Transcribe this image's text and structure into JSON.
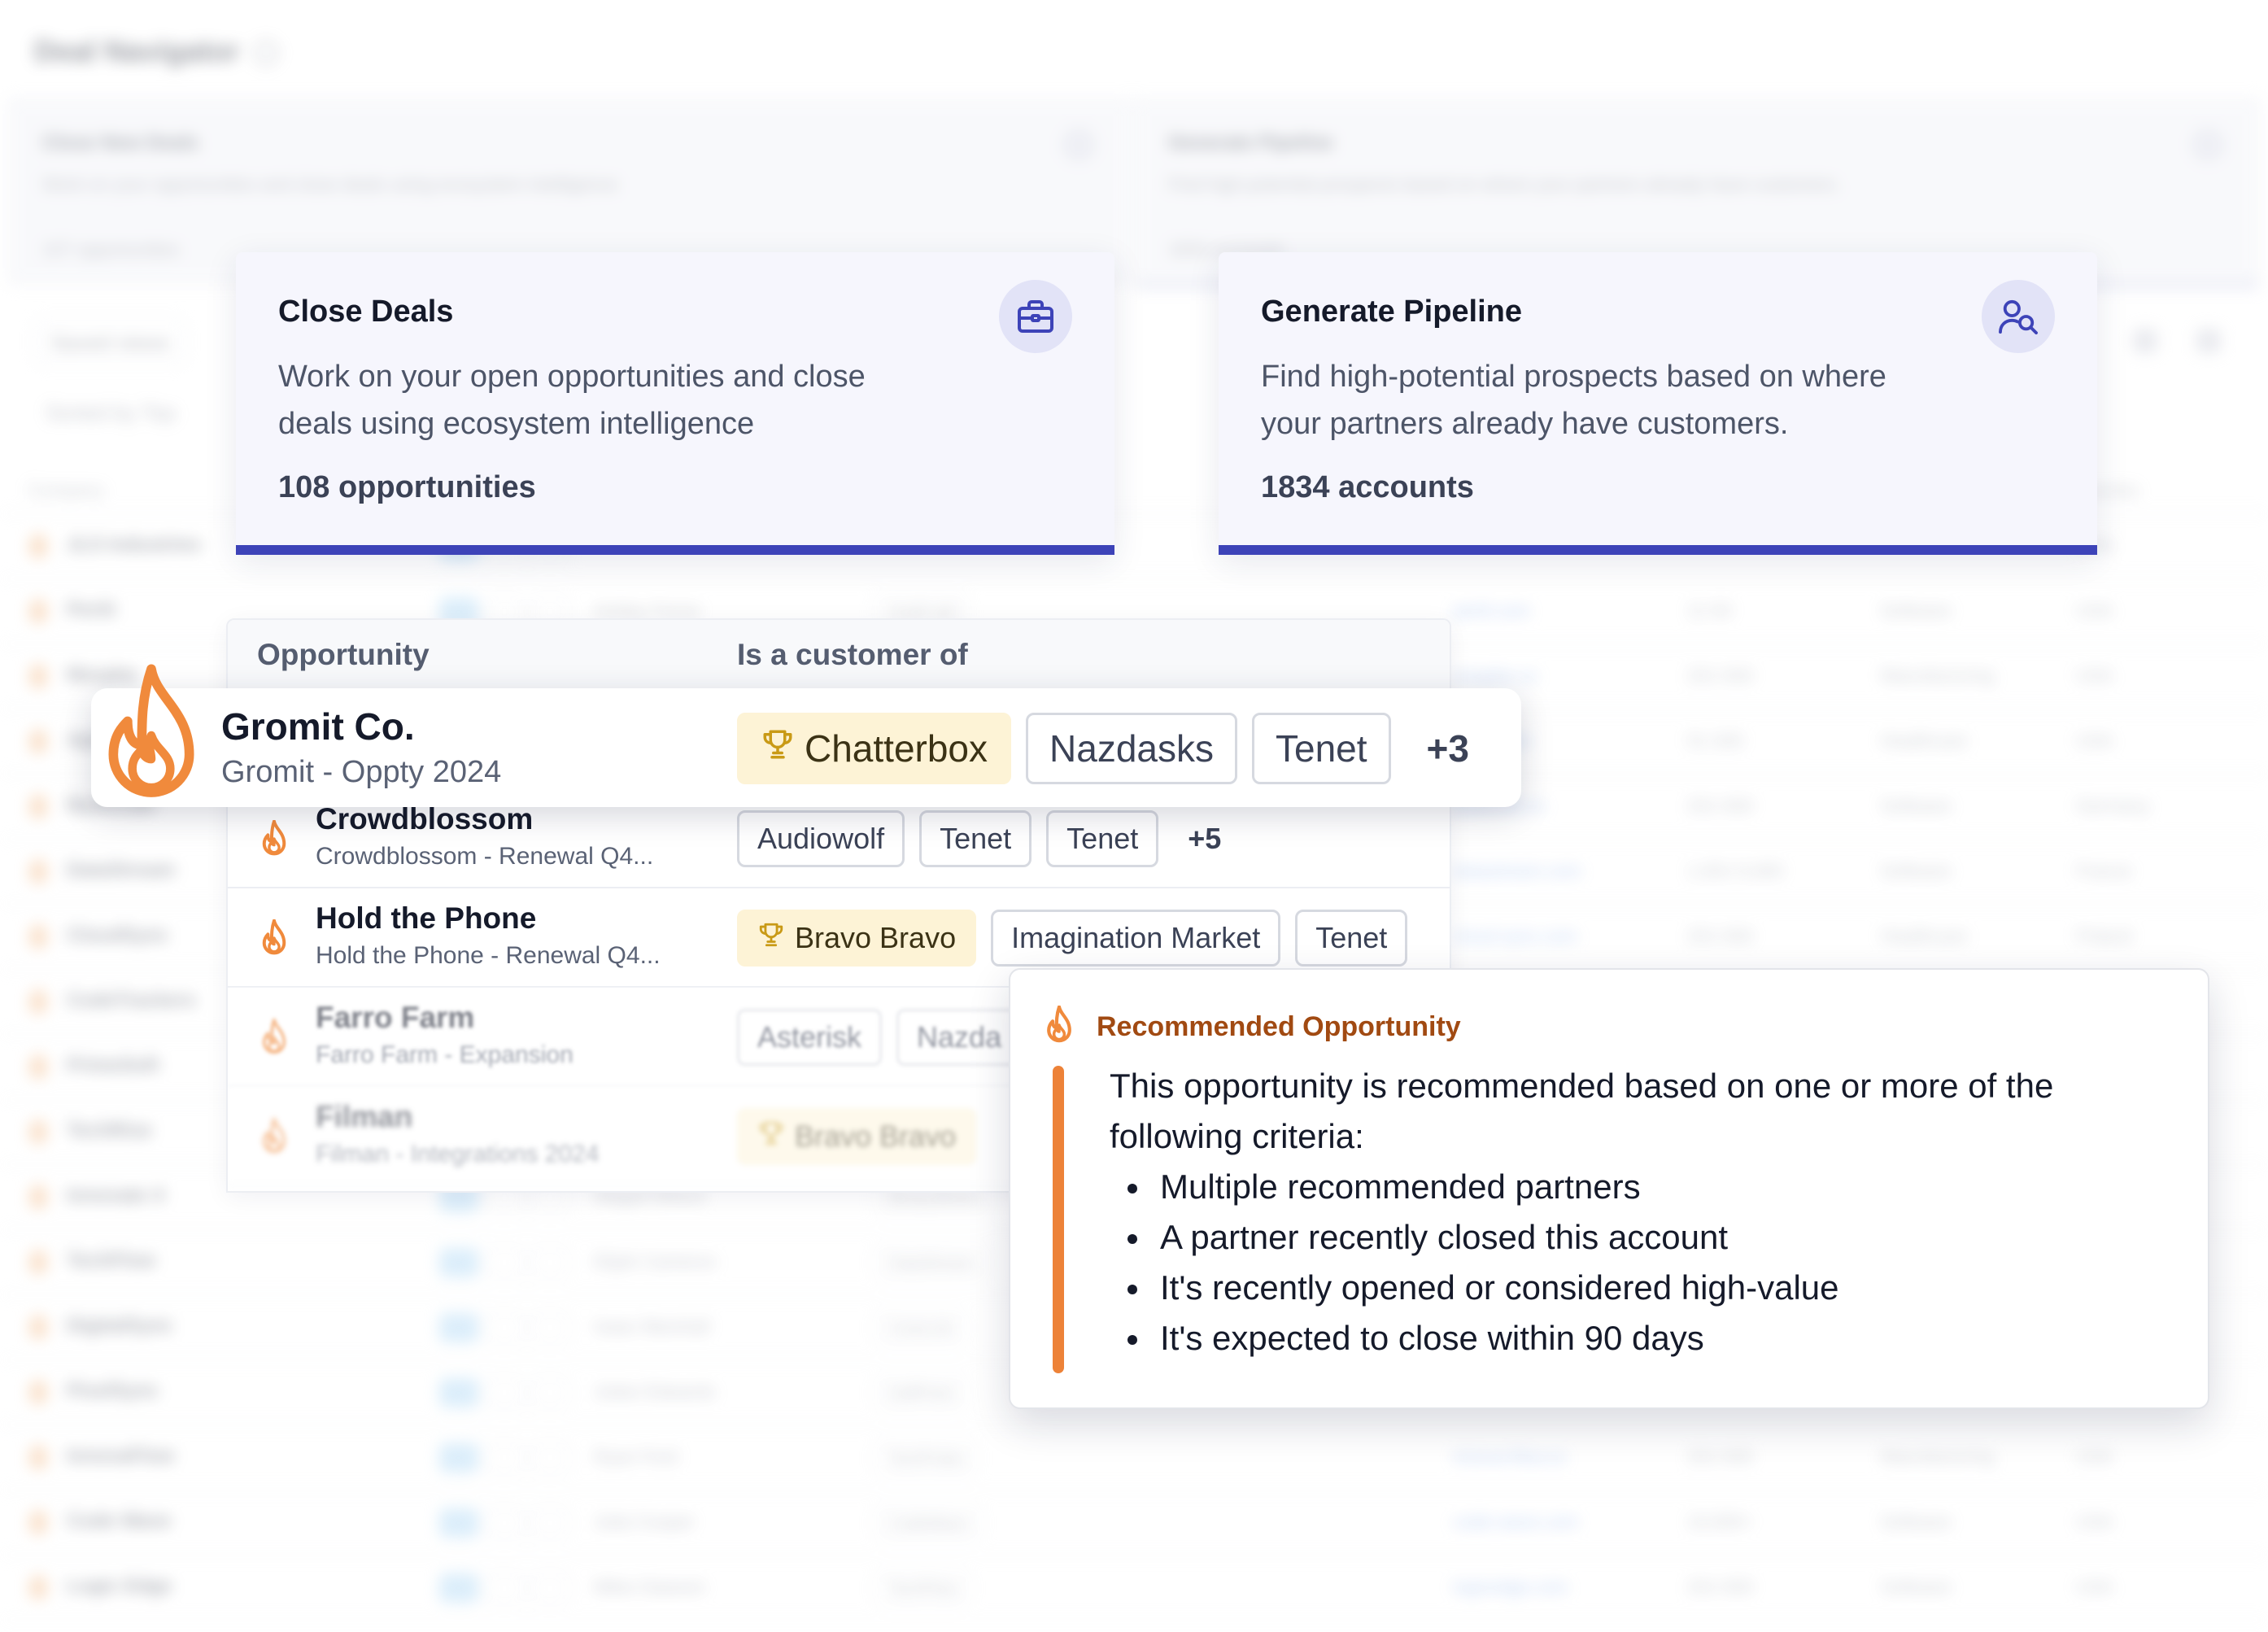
{
  "background": {
    "app_title": "Deal Navigator",
    "cards": [
      {
        "title": "Close New Deals",
        "desc": "Work on your opportunities and close deals using ecosystem intelligence",
        "count": "107 opportunities"
      },
      {
        "title": "Generate Pipeline",
        "desc": "Find high-potential prospects based on where your partners already have customers.",
        "count": "1834 accounts"
      }
    ],
    "saved_views": "Saved views",
    "sorted_by": "Sorted by Top",
    "columns": {
      "company": "Company",
      "country": "Country"
    },
    "rows": [
      {
        "company": "JLS Industries",
        "person": "",
        "tag": "",
        "domain": "",
        "employees": "",
        "industry": "",
        "country": "USA"
      },
      {
        "company": "Periti",
        "person": "Ashley Ferrer",
        "tag": "SmilCraft",
        "domain": "periti.com",
        "employees": "11-50",
        "industry": "Software",
        "country": "USA"
      },
      {
        "company": "Morphe",
        "person": "",
        "tag": "",
        "domain": "morphe.co",
        "employees": "201-500",
        "industry": "Manufacturing",
        "country": "USA"
      },
      {
        "company": "Apex",
        "person": "",
        "tag": "",
        "domain": "apex.com",
        "employees": "51-200",
        "industry": "Healthcare",
        "country": "USA"
      },
      {
        "company": "ByteCraft",
        "person": "",
        "tag": "",
        "domain": "bytecraft.co",
        "employees": "201-500",
        "industry": "Software",
        "country": "Germany"
      },
      {
        "company": "DataStream",
        "person": "",
        "tag": "",
        "domain": "datastream.com",
        "employees": "1,001-5,000",
        "industry": "Software",
        "country": "France"
      },
      {
        "company": "CloudSync",
        "person": "",
        "tag": "",
        "domain": "cloud-sync.com",
        "employees": "201-500",
        "industry": "Healthcare",
        "country": "Poland"
      },
      {
        "company": "CodeTrackers",
        "person": "",
        "tag": "",
        "domain": "",
        "employees": "",
        "industry": "",
        "country": ""
      },
      {
        "company": "PrimeSoft",
        "person": "",
        "tag": "",
        "domain": "",
        "employees": "",
        "industry": "",
        "country": ""
      },
      {
        "company": "TechRise",
        "person": "",
        "tag": "",
        "domain": "",
        "employees": "",
        "industry": "",
        "country": ""
      },
      {
        "company": "Innovate X",
        "person": "Abigail Wilson",
        "tag": "BinaryWorks",
        "domain": "",
        "employees": "",
        "industry": "",
        "country": ""
      },
      {
        "company": "TechFlow",
        "person": "Elijah Cameron",
        "tag": "DataStream",
        "domain": "",
        "employees": "",
        "industry": "",
        "country": ""
      },
      {
        "company": "DigitalSync",
        "person": "Isaac Marshall",
        "tag": "CoreLink",
        "domain": "",
        "employees": "",
        "industry": "",
        "country": ""
      },
      {
        "company": "PixelSync",
        "person": "Julian Edwards",
        "tag": "SoftPoint",
        "domain": "",
        "employees": "",
        "industry": "",
        "country": ""
      },
      {
        "company": "InnovaFlow",
        "person": "Ryan Ford",
        "tag": "TechPulse",
        "domain": "innova-flow.co",
        "employees": "201-500",
        "industry": "Manufacturing",
        "country": "USA"
      },
      {
        "company": "Code Wave",
        "person": "Julia Cooper",
        "tag": "CodeWave",
        "domain": "code-wave.com",
        "employees": "10,000+",
        "industry": "Software",
        "country": "USA"
      },
      {
        "company": "Logic Edge",
        "person": "Miles Dawson",
        "tag": "TechFlow",
        "domain": "logicedge.com",
        "employees": "201-500",
        "industry": "Software",
        "country": "USA"
      }
    ]
  },
  "cards": {
    "close_deals": {
      "title": "Close Deals",
      "desc": "Work on your open opportunities and close deals using ecosystem intelligence",
      "count": "108 opportunities",
      "icon": "briefcase-icon"
    },
    "generate_pipeline": {
      "title": "Generate Pipeline",
      "desc": "Find high-potential prospects based on where your partners already have customers.",
      "count": "1834 accounts",
      "icon": "user-search-icon"
    }
  },
  "table": {
    "headers": {
      "opportunity": "Opportunity",
      "customer_of": "Is a customer of"
    },
    "highlight": {
      "name": "Gromit Co.",
      "sub": "Gromit - Oppty 2024",
      "chips": [
        "Chatterbox",
        "Nazdasks",
        "Tenet"
      ],
      "gold_chip": "Chatterbox",
      "more": "+3"
    },
    "rows": [
      {
        "name": "Crowdblossom",
        "sub": "Crowdblossom - Renewal Q4...",
        "chips": [
          "Audiowolf",
          "Tenet",
          "Tenet"
        ],
        "more": "+5"
      },
      {
        "name": "Hold the Phone",
        "sub": "Hold the Phone - Renewal Q4...",
        "gold_chip": "Bravo Bravo",
        "chips": [
          "Imagination Market",
          "Tenet"
        ]
      },
      {
        "name": "Farro Farm",
        "sub": "Farro Farm - Expansion",
        "chips": [
          "Asterisk",
          "Nazda"
        ]
      },
      {
        "name": "Filman",
        "sub": "Filman - Integrations 2024",
        "gold_chip": "Bravo Bravo"
      }
    ]
  },
  "tooltip": {
    "title": "Recommended Opportunity",
    "intro": "This opportunity is recommended based on one or more of the following criteria:",
    "criteria": [
      "Multiple recommended partners",
      "A partner recently closed this account",
      "It's recently opened or considered high-value",
      "It's expected to close within 90 days"
    ]
  },
  "colors": {
    "accent": "#3d43b8",
    "flame": "#f08a3c",
    "gold_chip_bg": "#fdf3d6",
    "tooltip_title": "#a14a12"
  }
}
